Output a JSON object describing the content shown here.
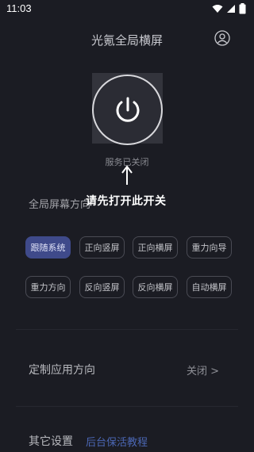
{
  "status_bar": {
    "time": "11:03"
  },
  "header": {
    "title": "光氪全局横屏"
  },
  "power": {
    "status": "服务已关闭",
    "hint": "请先打开此开关"
  },
  "global_orientation": {
    "label": "全局屏幕方向",
    "options_row1": [
      "跟随系统",
      "正向竖屏",
      "正向横屏",
      "重力向导"
    ],
    "options_row2": [
      "重力方向",
      "反向竖屏",
      "反向横屏",
      "自动横屏"
    ],
    "selected": "跟随系统"
  },
  "custom_app": {
    "label": "定制应用方向",
    "value": "关闭 >"
  },
  "other": {
    "label": "其它设置",
    "link": "后台保活教程"
  },
  "colors": {
    "background": "#1b1c23",
    "accent_chip": "#3f4a8a",
    "link": "#4b67b4"
  }
}
